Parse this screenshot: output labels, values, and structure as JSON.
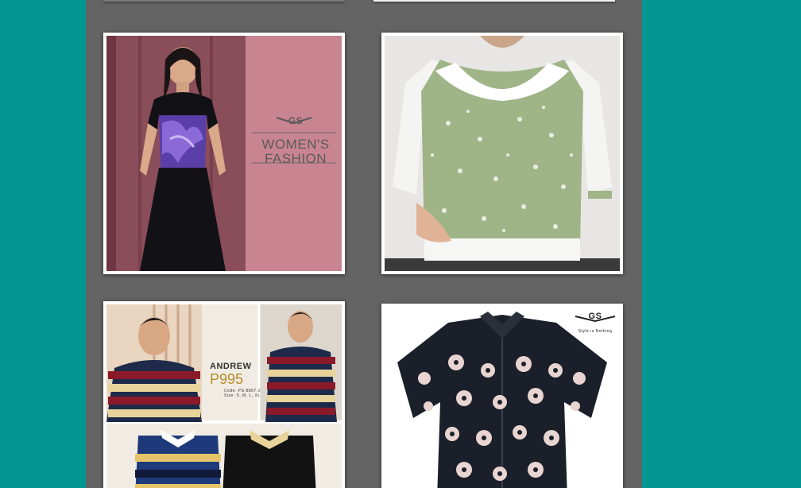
{
  "gallery": {
    "cards": [
      {
        "id": "womens-fashion",
        "logo_text": "GS",
        "title_line1": "WOMEN'S",
        "title_line2": "FASHION"
      },
      {
        "id": "green-floral-top"
      },
      {
        "id": "andrew-polo",
        "name": "ANDREW",
        "model": "P995",
        "code_line": "Code: PS-8867-2",
        "size_line": "Size: S, M, L, XL"
      },
      {
        "id": "floral-shirt",
        "logo_text": "GS",
        "tagline": "Style is Nothing"
      }
    ]
  },
  "colors": {
    "page_background": "#049792",
    "panel_background": "#646464",
    "card_frame": "#ffffff"
  }
}
